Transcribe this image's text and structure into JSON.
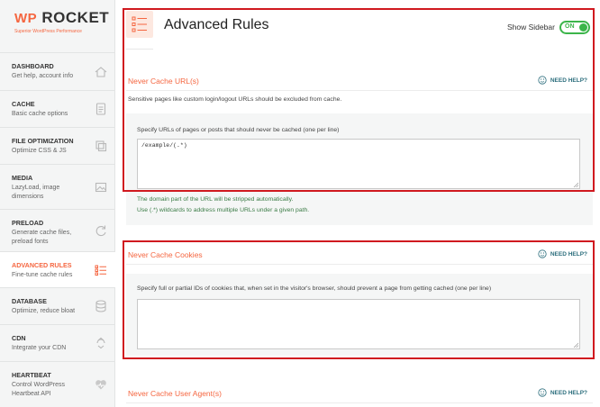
{
  "brand": {
    "name_wp": "WP",
    "name_rocket": "ROCKET",
    "tagline": "Superior WordPress Performance"
  },
  "nav": [
    {
      "title": "DASHBOARD",
      "desc": "Get help, account info",
      "icon": "home-icon"
    },
    {
      "title": "CACHE",
      "desc": "Basic cache options",
      "icon": "document-icon"
    },
    {
      "title": "FILE OPTIMIZATION",
      "desc": "Optimize CSS & JS",
      "icon": "layers-icon"
    },
    {
      "title": "MEDIA",
      "desc": "LazyLoad, image dimensions",
      "icon": "image-icon"
    },
    {
      "title": "PRELOAD",
      "desc": "Generate cache files, preload fonts",
      "icon": "refresh-icon"
    },
    {
      "title": "ADVANCED RULES",
      "desc": "Fine-tune cache rules",
      "icon": "list-icon",
      "active": true
    },
    {
      "title": "DATABASE",
      "desc": "Optimize, reduce bloat",
      "icon": "database-icon"
    },
    {
      "title": "CDN",
      "desc": "Integrate your CDN",
      "icon": "cdn-icon"
    },
    {
      "title": "HEARTBEAT",
      "desc": "Control WordPress Heartbeat API",
      "icon": "heart-icon"
    }
  ],
  "header": {
    "title": "Advanced Rules",
    "show_sidebar_label": "Show Sidebar",
    "toggle_label": "ON"
  },
  "sections": {
    "urls": {
      "title": "Never Cache URL(s)",
      "help": "NEED HELP?",
      "description": "Sensitive pages like custom login/logout URLs should be excluded from cache.",
      "field_label": "Specify URLs of pages or posts that should never be cached (one per line)",
      "value": "/example/(.*)",
      "note1": "The domain part of the URL will be stripped automatically.",
      "note2": "Use (.*) wildcards to address multiple URLs under a given path."
    },
    "cookies": {
      "title": "Never Cache Cookies",
      "help": "NEED HELP?",
      "field_label": "Specify full or partial IDs of cookies that, when set in the visitor's browser, should prevent a page from getting cached (one per line)",
      "value": ""
    },
    "agents": {
      "title": "Never Cache User Agent(s)",
      "help": "NEED HELP?"
    }
  },
  "colors": {
    "accent": "#f56640",
    "toggle_on": "#3bb54a",
    "highlight": "#d0191f",
    "help_link": "#2c6e7d"
  }
}
